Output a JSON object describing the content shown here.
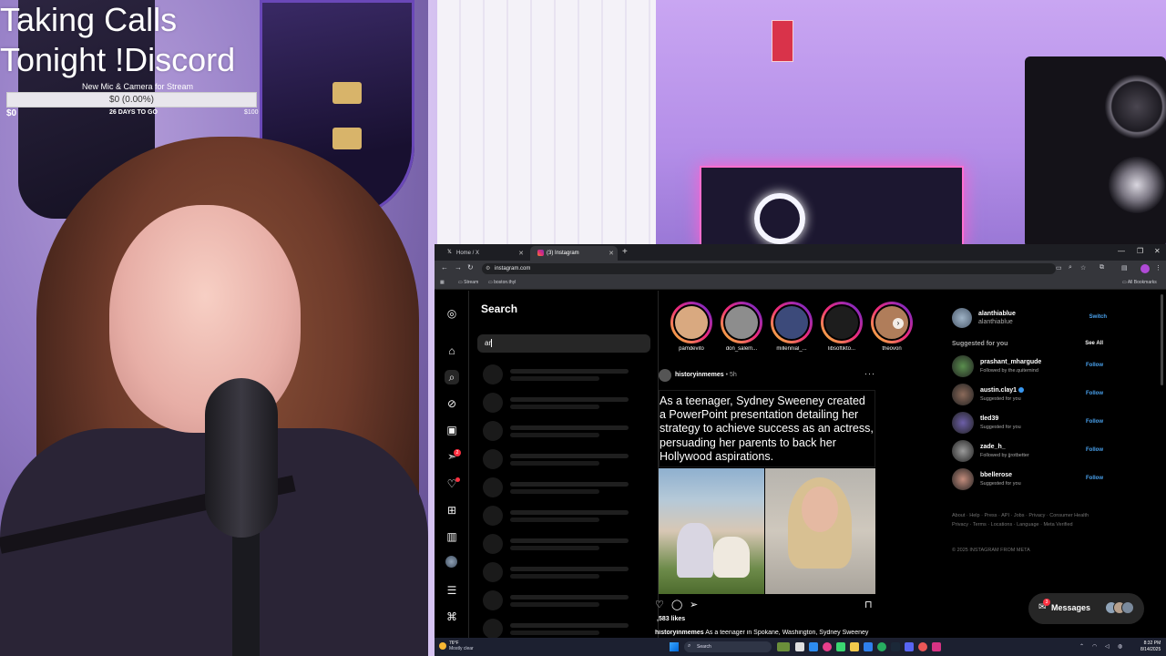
{
  "overlay": {
    "title_line1": "Taking Calls",
    "title_line2": "Tonight !Discord",
    "goal_label": "New Mic & Camera for Stream",
    "goal_progress_text": "$0 (0.00%)",
    "goal_progress": 0,
    "goal_min": "$0",
    "goal_days": "26 DAYS TO GO",
    "goal_max": "$100"
  },
  "browser": {
    "tabs": [
      {
        "label": "Home / X",
        "icon": "x-logo-icon"
      },
      {
        "label": "(3) Instagram",
        "icon": "instagram-icon"
      }
    ],
    "url": "instagram.com",
    "bookmarks": [
      "Stream",
      "boston.thyl"
    ],
    "all_bookmarks": "All Bookmarks"
  },
  "instagram": {
    "search": {
      "title": "Search",
      "query": "ar",
      "skeleton_rows": 10
    },
    "rail_icons": [
      "instagram-logo-icon",
      "home-icon",
      "search-icon",
      "explore-icon",
      "reels-icon",
      "direct-icon",
      "notifications-icon",
      "create-icon",
      "dashboard-icon",
      "profile-icon",
      "menu-icon",
      "threads-icon"
    ],
    "direct_badge": "2",
    "stories": [
      {
        "name": "pamdevito",
        "color": "#d9a980"
      },
      {
        "name": "don_salem...",
        "color": "#8d8d8d"
      },
      {
        "name": "millennial_...",
        "color": "#3c4a7a"
      },
      {
        "name": "libsoftikto...",
        "color": "#1d1d1d"
      },
      {
        "name": "theovon",
        "color": "#b07d5a"
      }
    ],
    "post": {
      "user": "historyinmemes",
      "time": "• 5h",
      "text": "As a teenager, Sydney Sweeney created a PowerPoint presentation detailing her strategy to achieve success as an actress, persuading her parents to back her Hollywood aspirations.",
      "likes": ",583 likes",
      "caption_user": "historyinmemes",
      "caption_text": "As a teenager in Spokane, Washington, Sydney Sweeney"
    },
    "account": {
      "username": "alanthiablue",
      "name": "alanthiablue",
      "switch_label": "Switch"
    },
    "suggested": {
      "heading": "Suggested for you",
      "see_all": "See All",
      "follow_label": "Follow",
      "items": [
        {
          "name": "prashant_mhargude",
          "sub": "Followed by the.quitemind",
          "color": "#5a8f4e",
          "verified": false
        },
        {
          "name": "austin.clay1",
          "sub": "Suggested for you",
          "color": "#8b6a5a",
          "verified": true
        },
        {
          "name": "tled39",
          "sub": "Suggested for you",
          "color": "#6d5fa8",
          "verified": false
        },
        {
          "name": "zade_h_",
          "sub": "Followed by jjrotbetter",
          "color": "#9a9a9a",
          "verified": false
        },
        {
          "name": "bbellerose",
          "sub": "Suggested for you",
          "color": "#c48d7d",
          "verified": false
        }
      ]
    },
    "footer": {
      "links": "About · Help · Press · API · Jobs · Privacy · Consumer Health Privacy · Terms · Locations · Language · Meta Verified",
      "copyright": "© 2025 INSTAGRAM FROM META"
    },
    "messages": {
      "label": "Messages",
      "badge": "3"
    }
  },
  "taskbar": {
    "weather_temp": "76°F",
    "weather_desc": "Mostly clear",
    "search_placeholder": "Search",
    "time": "8:32 PM",
    "date": "8/14/2025"
  }
}
